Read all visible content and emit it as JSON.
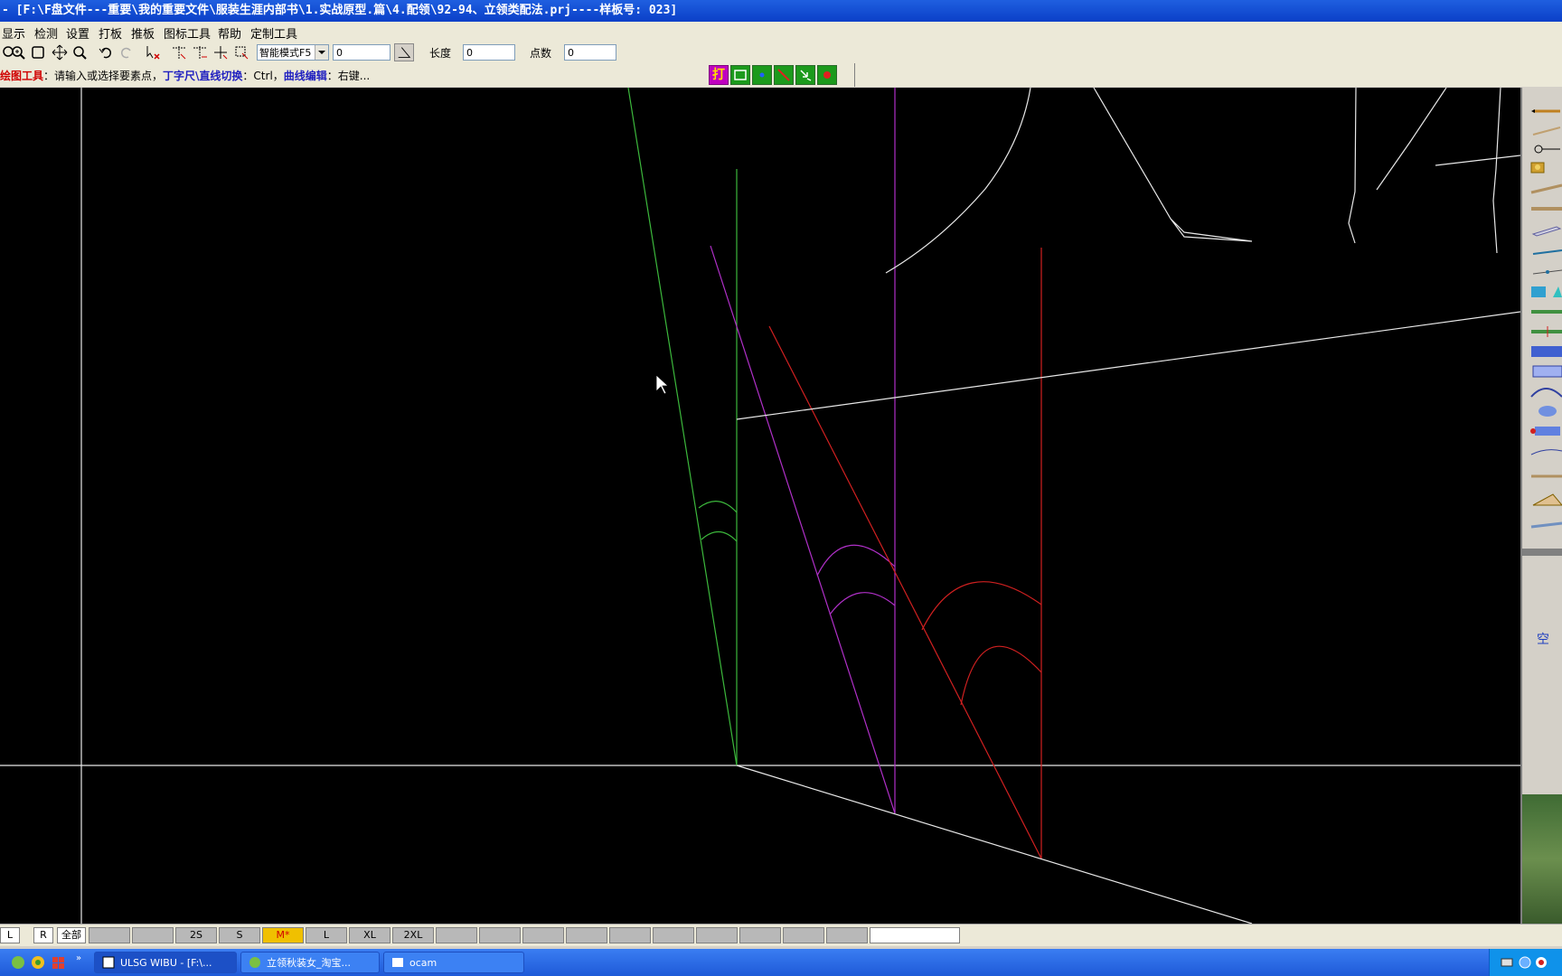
{
  "window": {
    "title": "- [F:\\F盘文件---重要\\我的重要文件\\服装生涯内部书\\1.实战原型.篇\\4.配领\\92-94、立领类配法.prj----样板号: 023]"
  },
  "menu": [
    "显示",
    "检测",
    "设置",
    "打板",
    "推板",
    "图标工具",
    "帮助",
    "定制工具"
  ],
  "toolbar": {
    "mode_select": "智能模式F5",
    "mode_value": "0",
    "length_label": "长度",
    "length_value": "0",
    "points_label": "点数",
    "points_value": "0"
  },
  "hint": {
    "part1": "绘图工具",
    "sep1": "：请输入或选择要素点，",
    "part2": "丁字尺\\直线切换",
    "sep2": "：Ctrl，",
    "part3": "曲线编辑",
    "sep3": "：右键..."
  },
  "mini_toolbar": {
    "print_label": "打"
  },
  "right_panel": {
    "empty_label": "空"
  },
  "size_bar": {
    "buttons": [
      "L",
      "R",
      "全部"
    ],
    "sizes": [
      "",
      "",
      "2S",
      "S",
      "M*",
      "L",
      "XL",
      "2XL",
      "",
      "",
      "",
      "",
      "",
      "",
      "",
      "",
      "",
      "",
      ""
    ],
    "active_size": "M*"
  },
  "taskbar": {
    "tasks": [
      "ULSG WIBU - [F:\\...",
      "立领秋装女_淘宝...",
      "ocam"
    ]
  },
  "colors": {
    "green": "#3cb83c",
    "magenta": "#b030c8",
    "red": "#d02020",
    "white": "#e8e8e8"
  }
}
